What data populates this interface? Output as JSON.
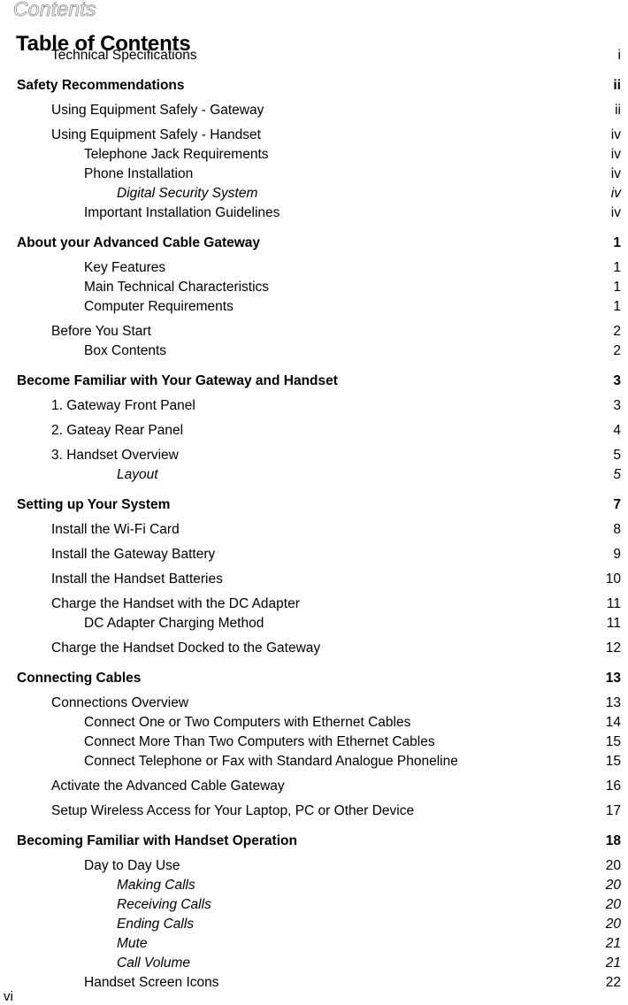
{
  "running_head": "Contents",
  "page_title": "Table of Contents",
  "folio": "vi",
  "entries": [
    {
      "title": "Technical Specifications",
      "page": "i",
      "level": 1,
      "style": "normal",
      "gap": "none"
    },
    {
      "title": "Safety Recommendations",
      "page": "ii",
      "level": 0,
      "style": "bold",
      "gap": "before"
    },
    {
      "title": "Using Equipment Safely - Gateway",
      "page": "ii",
      "level": 1,
      "style": "normal",
      "gap": "small"
    },
    {
      "title": "Using Equipment Safely - Handset",
      "page": "iv",
      "level": 1,
      "style": "normal",
      "gap": "small"
    },
    {
      "title": "Telephone Jack Requirements",
      "page": "iv",
      "level": 2,
      "style": "normal",
      "gap": "none"
    },
    {
      "title": "Phone Installation",
      "page": "iv",
      "level": 2,
      "style": "normal",
      "gap": "none"
    },
    {
      "title": "Digital Security System",
      "page": "iv",
      "level": 3,
      "style": "italic",
      "gap": "none"
    },
    {
      "title": "Important Installation Guidelines",
      "page": "iv",
      "level": 2,
      "style": "normal",
      "gap": "none"
    },
    {
      "title": "About your Advanced Cable Gateway",
      "page": "1",
      "level": 0,
      "style": "bold",
      "gap": "before"
    },
    {
      "title": "Key Features",
      "page": "1",
      "level": 2,
      "style": "normal",
      "gap": "small"
    },
    {
      "title": "Main Technical Characteristics",
      "page": "1",
      "level": 2,
      "style": "normal",
      "gap": "none"
    },
    {
      "title": "Computer Requirements",
      "page": "1",
      "level": 2,
      "style": "normal",
      "gap": "none"
    },
    {
      "title": "Before You Start",
      "page": "2",
      "level": 1,
      "style": "normal",
      "gap": "small"
    },
    {
      "title": "Box Contents",
      "page": "2",
      "level": 2,
      "style": "normal",
      "gap": "none"
    },
    {
      "title": "Become Familiar with Your Gateway and Handset",
      "page": "3",
      "level": 0,
      "style": "bold",
      "gap": "before"
    },
    {
      "title": "1. Gateway Front Panel",
      "page": "3",
      "level": 1,
      "style": "normal",
      "gap": "small"
    },
    {
      "title": "2. Gateay Rear Panel",
      "page": "4",
      "level": 1,
      "style": "normal",
      "gap": "small"
    },
    {
      "title": "3. Handset Overview",
      "page": "5",
      "level": 1,
      "style": "normal",
      "gap": "small"
    },
    {
      "title": "Layout",
      "page": "5",
      "level": 3,
      "style": "italic",
      "gap": "none"
    },
    {
      "title": "Setting up Your System",
      "page": "7",
      "level": 0,
      "style": "bold",
      "gap": "before"
    },
    {
      "title": "Install the Wi-Fi Card",
      "page": "8",
      "level": 1,
      "style": "normal",
      "gap": "small"
    },
    {
      "title": "Install the Gateway Battery",
      "page": "9",
      "level": 1,
      "style": "normal",
      "gap": "small"
    },
    {
      "title": "Install the Handset Batteries",
      "page": "10",
      "level": 1,
      "style": "normal",
      "gap": "small"
    },
    {
      "title": "Charge the Handset with the DC Adapter",
      "page": "11",
      "level": 1,
      "style": "normal",
      "gap": "small"
    },
    {
      "title": "DC Adapter Charging Method",
      "page": "11",
      "level": 2,
      "style": "normal",
      "gap": "none"
    },
    {
      "title": "Charge the Handset Docked to the Gateway",
      "page": "12",
      "level": 1,
      "style": "normal",
      "gap": "small"
    },
    {
      "title": "Connecting Cables",
      "page": "13",
      "level": 0,
      "style": "bold",
      "gap": "before"
    },
    {
      "title": "Connections Overview",
      "page": "13",
      "level": 1,
      "style": "normal",
      "gap": "small"
    },
    {
      "title": "Connect One or Two Computers with Ethernet Cables",
      "page": "14",
      "level": 2,
      "style": "normal",
      "gap": "none"
    },
    {
      "title": "Connect More Than Two Computers with Ethernet Cables",
      "page": "15",
      "level": 2,
      "style": "normal",
      "gap": "none"
    },
    {
      "title": "Connect Telephone or Fax with Standard Analogue Phoneline",
      "page": "15",
      "level": 2,
      "style": "normal",
      "gap": "none"
    },
    {
      "title": "Activate the Advanced Cable Gateway",
      "page": "16",
      "level": 1,
      "style": "normal",
      "gap": "small"
    },
    {
      "title": "Setup Wireless Access for Your Laptop, PC or Other Device",
      "page": "17",
      "level": 1,
      "style": "normal",
      "gap": "small"
    },
    {
      "title": "Becoming Familiar with Handset Operation",
      "page": "18",
      "level": 0,
      "style": "bold",
      "gap": "before"
    },
    {
      "title": "Day to Day Use",
      "page": "20",
      "level": 2,
      "style": "normal",
      "gap": "small"
    },
    {
      "title": "Making Calls",
      "page": "20",
      "level": 3,
      "style": "italic",
      "gap": "none"
    },
    {
      "title": "Receiving Calls",
      "page": "20",
      "level": 3,
      "style": "italic",
      "gap": "none"
    },
    {
      "title": "Ending Calls",
      "page": "20",
      "level": 3,
      "style": "italic",
      "gap": "none"
    },
    {
      "title": "Mute",
      "page": "21",
      "level": 3,
      "style": "italic",
      "gap": "none"
    },
    {
      "title": "Call Volume",
      "page": "21",
      "level": 3,
      "style": "italic",
      "gap": "none"
    },
    {
      "title": "Handset Screen Icons",
      "page": "22",
      "level": 2,
      "style": "normal",
      "gap": "none"
    }
  ]
}
